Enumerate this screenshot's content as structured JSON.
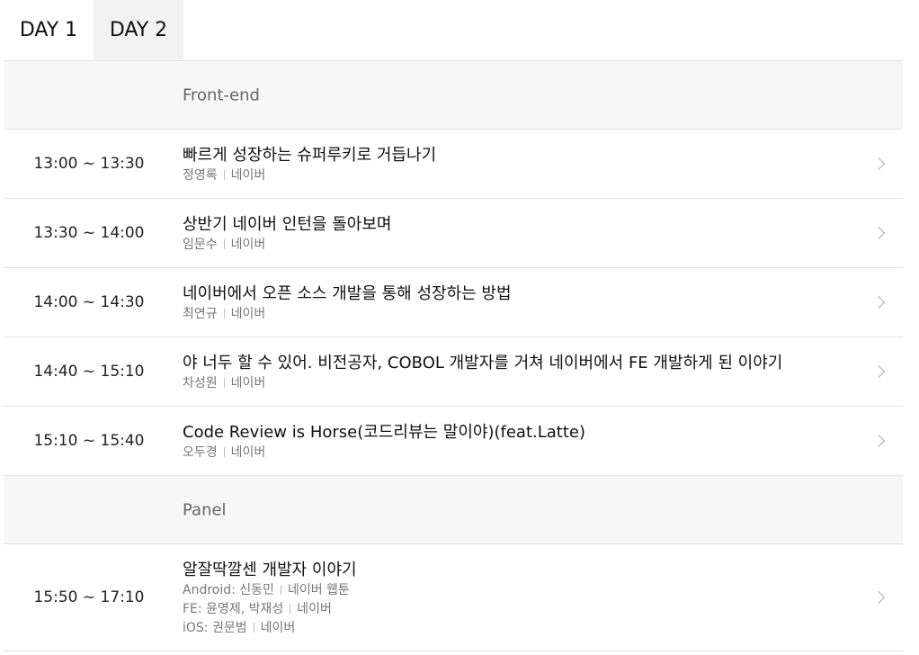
{
  "tabs": [
    {
      "label": "DAY 1"
    },
    {
      "label": "DAY 2",
      "selected": true
    }
  ],
  "sections": [
    {
      "name": "Front-end",
      "sessions": [
        {
          "time": "13:00 ~ 13:30",
          "title": "빠르게 성장하는 슈퍼루키로 거듭나기",
          "speaker": "정영록",
          "org": "네이버"
        },
        {
          "time": "13:30 ~ 14:00",
          "title": "상반기 네이버 인턴을 돌아보며",
          "speaker": "임문수",
          "org": "네이버"
        },
        {
          "time": "14:00 ~ 14:30",
          "title": "네이버에서 오픈 소스 개발을 통해 성장하는 방법",
          "speaker": "최연규",
          "org": "네이버"
        },
        {
          "time": "14:40 ~ 15:10",
          "title": "야 너두 할 수 있어. 비전공자, COBOL 개발자를 거쳐 네이버에서 FE 개발하게 된 이야기",
          "speaker": "차성원",
          "org": "네이버"
        },
        {
          "time": "15:10 ~ 15:40",
          "title": "Code Review is Horse(코드리뷰는 말이야)(feat.Latte)",
          "speaker": "오두경",
          "org": "네이버"
        }
      ]
    },
    {
      "name": "Panel",
      "sessions": [
        {
          "time": "15:50 ~ 17:10",
          "title": "알잘딱깔센 개발자 이야기",
          "speakers": [
            {
              "speaker": "Android: 신동민",
              "org": "네이버 웹툰"
            },
            {
              "speaker": "FE: 윤영제, 박재성",
              "org": "네이버"
            },
            {
              "speaker": "iOS: 권문범",
              "org": "네이버"
            }
          ]
        }
      ]
    }
  ],
  "icons": {
    "row_action": "chevron-right-icon"
  },
  "colors": {
    "selected_tab_bg": "#f2f2f2",
    "section_bg": "#f7f7f7",
    "divider": "#e2e2e2"
  }
}
